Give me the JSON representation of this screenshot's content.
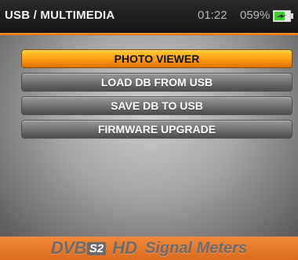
{
  "header": {
    "title": "USB / MULTIMEDIA",
    "time": "01:22",
    "battery_level": "059%",
    "battery_icon": "battery-charging-icon"
  },
  "menu": {
    "items": [
      {
        "label": "PHOTO VIEWER",
        "selected": true
      },
      {
        "label": "LOAD DB FROM USB",
        "selected": false
      },
      {
        "label": "SAVE DB TO USB",
        "selected": false
      },
      {
        "label": "FIRMWARE UPGRADE",
        "selected": false
      }
    ]
  },
  "footer": {
    "logo_dvb": "DVB",
    "logo_s2": "S2",
    "logo_hd": "HD",
    "logo_tagline": "Signal Meters"
  },
  "colors": {
    "accent_orange": "#f08a3c",
    "selected_orange": "#ffa41a",
    "header_bg": "#1e1e1e",
    "battery_green": "#3bd12a"
  }
}
